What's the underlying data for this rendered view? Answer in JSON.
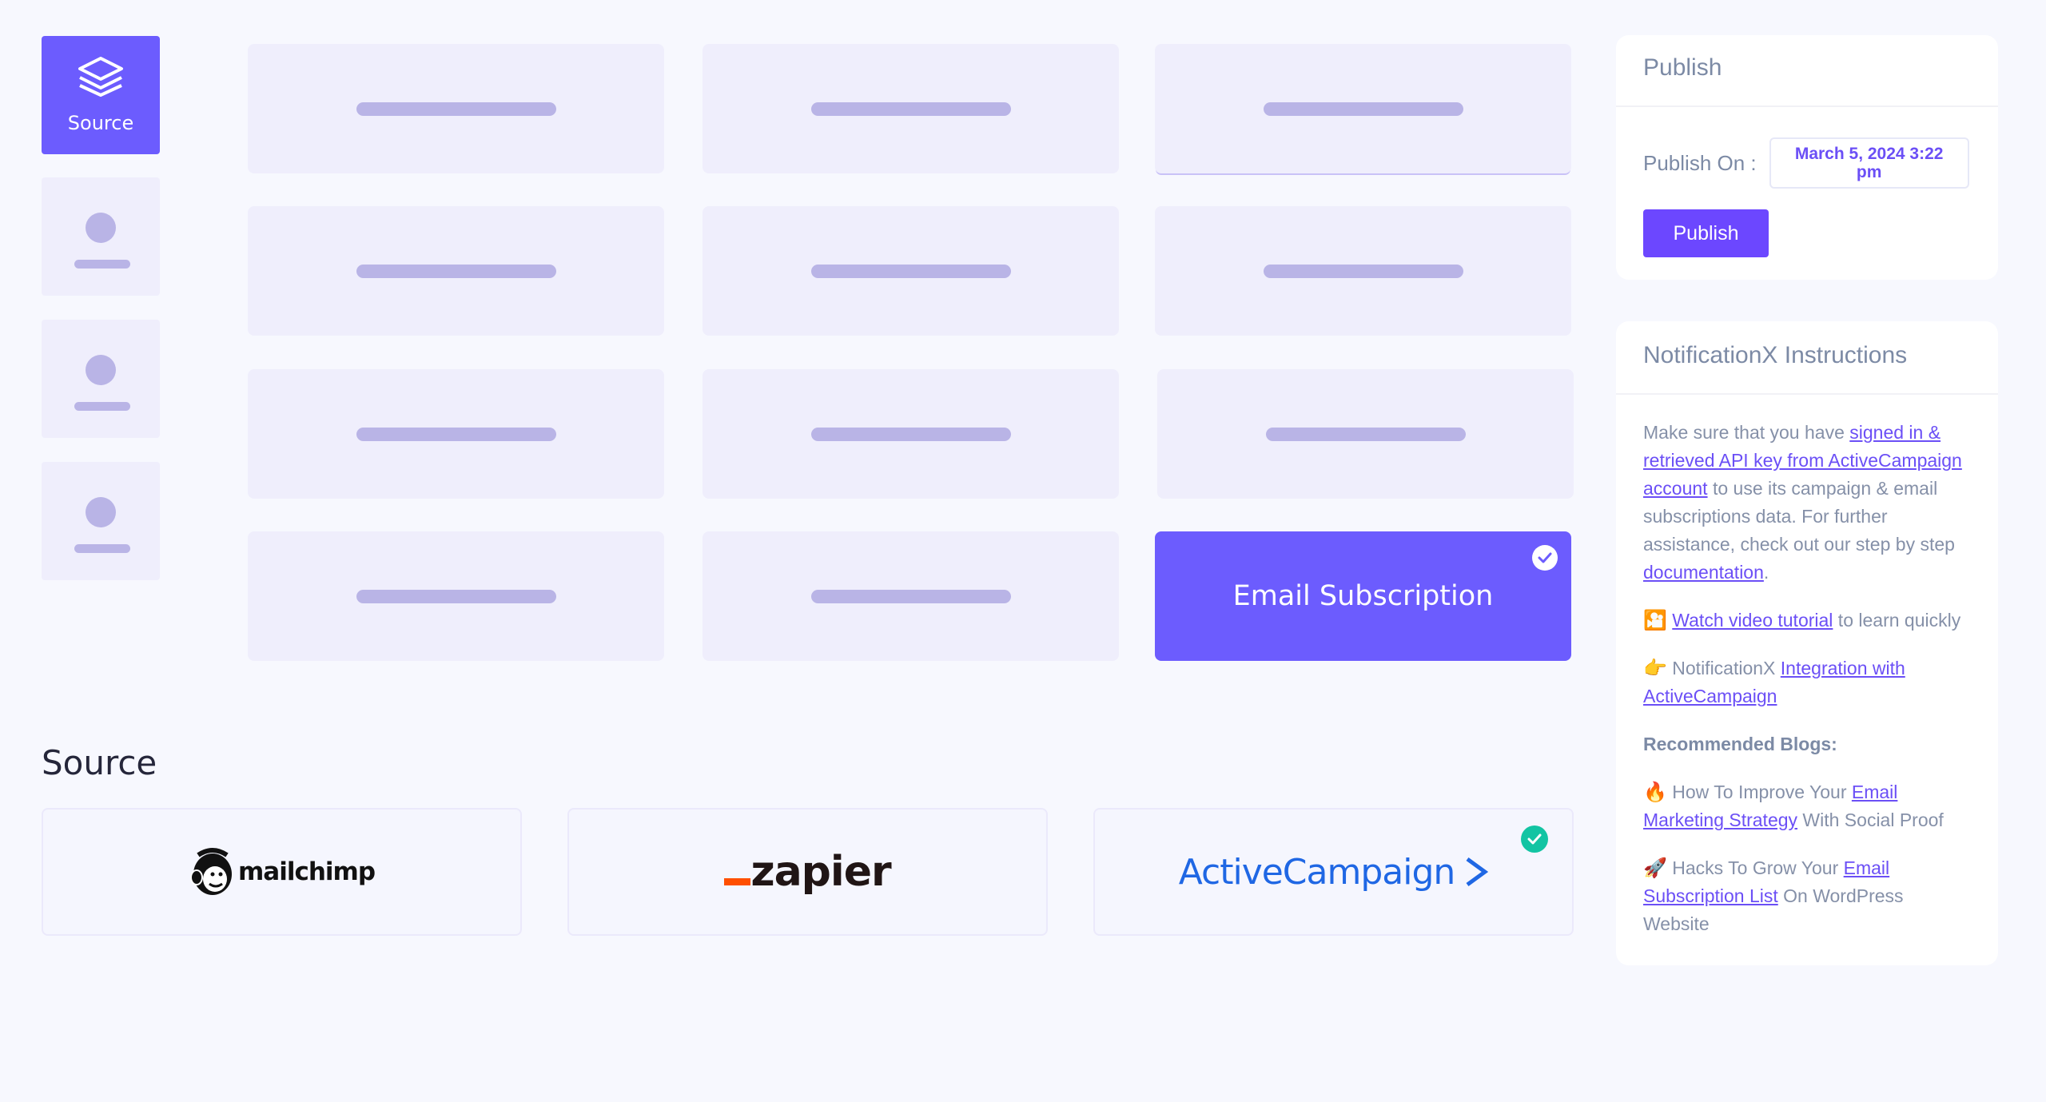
{
  "sidebar": {
    "active_item": {
      "label": "Source",
      "icon": "layers-icon"
    },
    "placeholder_items": 3
  },
  "type_grid": {
    "rows": 4,
    "columns": 3,
    "selected": {
      "label": "Email Subscription",
      "icon": "check-circle-icon"
    }
  },
  "source_section": {
    "title": "Source",
    "sources": [
      {
        "name": "mailchimp",
        "selected": false
      },
      {
        "name": "zapier",
        "selected": false
      },
      {
        "name": "ActiveCampaign",
        "selected": true
      }
    ]
  },
  "publish_panel": {
    "title": "Publish",
    "publish_on_label": "Publish On :",
    "publish_on_value": "March 5, 2024 3:22 pm",
    "publish_button": "Publish"
  },
  "instructions_panel": {
    "title": "NotificationX Instructions",
    "intro_before": "Make sure that you have ",
    "intro_link": "signed in & retrieved API key from ActiveCampaign account",
    "intro_middle": " to use its campaign & email subscriptions data. For further assistance, check out our step by step ",
    "intro_doc_link": "documentation",
    "intro_end": ".",
    "video_emoji": "🎦",
    "video_link": "Watch video tutorial",
    "video_after": " to learn quickly",
    "integration_emoji": "👉",
    "integration_before": " NotificationX ",
    "integration_link": "Integration with ActiveCampaign",
    "recommended_heading": "Recommended Blogs:",
    "blogs": [
      {
        "emoji": "🔥",
        "before": " How To Improve Your ",
        "link": "Email Marketing Strategy",
        "after": " With Social Proof"
      },
      {
        "emoji": "🚀",
        "before": " Hacks To Grow Your ",
        "link": "Email Subscription List",
        "after": " On WordPress Website"
      }
    ]
  },
  "colors": {
    "accent": "#6c5cfe",
    "button": "#6c47ff",
    "link": "#6b4ff6",
    "check_green": "#13c4a3",
    "placeholder_tile": "#efeefc",
    "placeholder_bar": "#b9b4e6",
    "background": "#f7f8fe"
  }
}
